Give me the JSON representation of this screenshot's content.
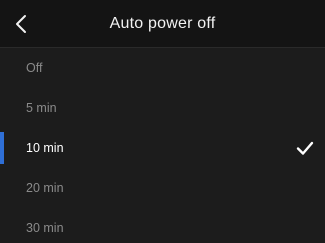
{
  "header": {
    "title": "Auto power off",
    "back_icon": "chevron-left-icon"
  },
  "options": [
    {
      "label": "Off",
      "selected": false
    },
    {
      "label": "5 min",
      "selected": false
    },
    {
      "label": "10 min",
      "selected": true
    },
    {
      "label": "20 min",
      "selected": false
    },
    {
      "label": "30 min",
      "selected": false
    }
  ],
  "selected_icon": "checkmark-icon",
  "colors": {
    "background": "#1c1c1c",
    "header_background": "#141414",
    "accent": "#2f6fd6",
    "text_primary": "#ffffff",
    "text_secondary": "#8a8a8a"
  }
}
